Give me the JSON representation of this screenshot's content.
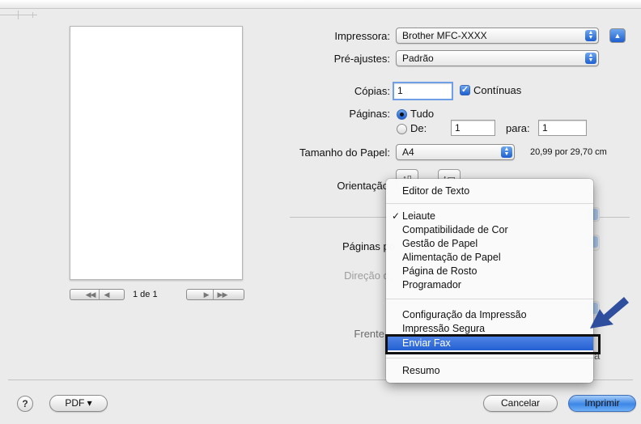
{
  "sheet": {
    "printer_label": "Impressora:",
    "printer_value": "Brother MFC-XXXX",
    "presets_label": "Pré-ajustes:",
    "presets_value": "Padrão",
    "copies_label": "Cópias:",
    "copies_value": "1",
    "collated_label": "Contínuas",
    "pages_label": "Páginas:",
    "pages_all_label": "Tudo",
    "pages_from_label": "De:",
    "pages_from_value": "1",
    "pages_to_label": "para:",
    "pages_to_value": "1",
    "paper_size_label": "Tamanho do Papel:",
    "paper_size_value": "A4",
    "paper_size_dims": "20,99 por 29,70 cm",
    "orientation_label": "Orientação",
    "pages_per_sheet_label": "Páginas po",
    "layout_direction_label": "Direção do",
    "two_sided_label": "Frente",
    "ghost_trailing_char": "a"
  },
  "preview": {
    "page_indicator": "1 de 1"
  },
  "menu": {
    "items": [
      {
        "label": "Editor de Texto"
      },
      {
        "label": "Leiaute",
        "checked": true
      },
      {
        "label": "Compatibilidade de Cor"
      },
      {
        "label": "Gestão de Papel"
      },
      {
        "label": "Alimentação de Papel"
      },
      {
        "label": "Página de Rosto"
      },
      {
        "label": "Programador"
      },
      {
        "label": "Configuração da Impressão"
      },
      {
        "label": "Impressão Segura"
      },
      {
        "label": "Enviar Fax",
        "selected": true
      },
      {
        "label": "Resumo"
      }
    ],
    "check_mark": "✓"
  },
  "footer": {
    "help": "?",
    "pdf_button": "PDF ▾",
    "cancel_button": "Cancelar",
    "print_button": "Imprimir"
  },
  "colors": {
    "accent": "#2460d2",
    "callout_arrow": "#2f4f9e"
  }
}
